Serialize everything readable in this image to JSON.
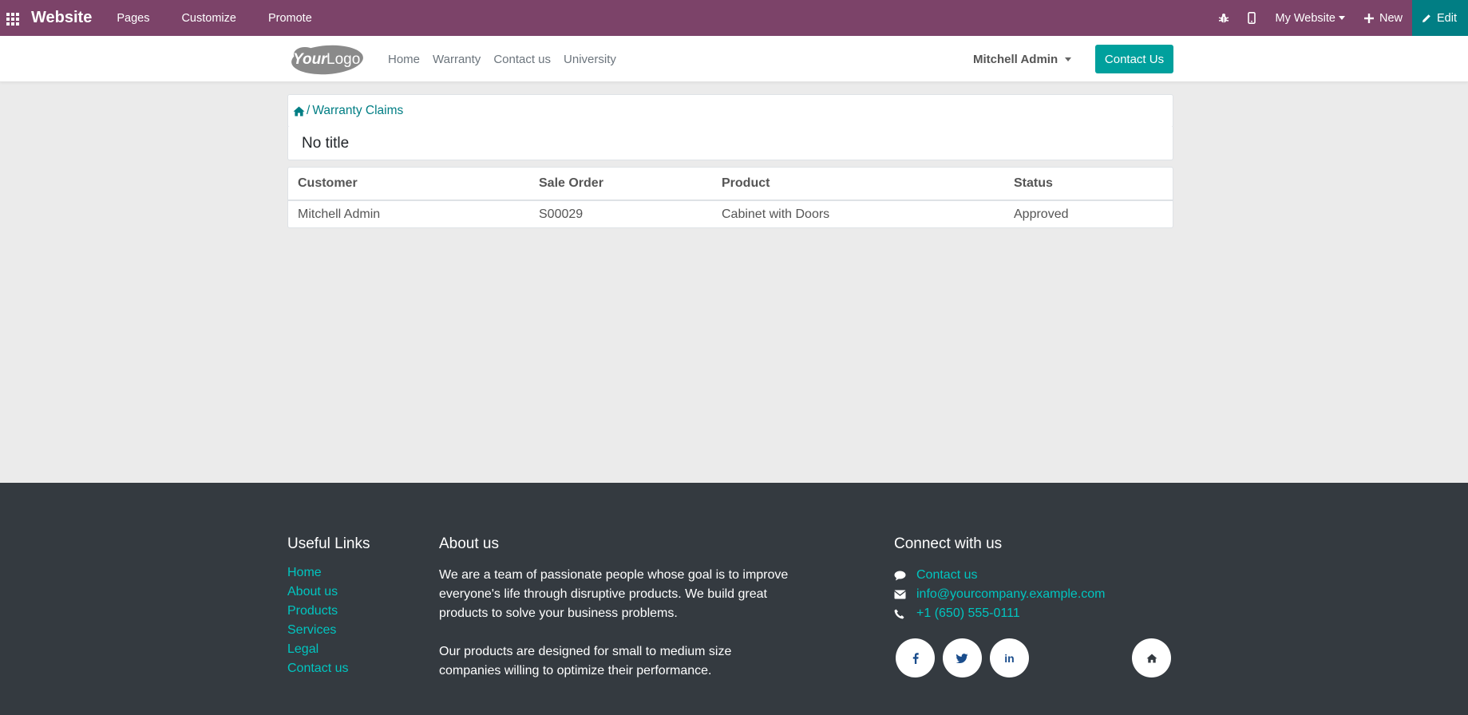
{
  "admin_bar": {
    "brand": "Website",
    "menu": [
      "Pages",
      "Customize",
      "Promote"
    ],
    "right": {
      "website_selector": "My Website",
      "new_label": "New",
      "edit_label": "Edit"
    },
    "colors": {
      "background": "#7c4369",
      "edit_background": "#017e84"
    }
  },
  "header": {
    "logo_text": "YourLogo",
    "nav": [
      "Home",
      "Warranty",
      "Contact us",
      "University"
    ],
    "user": "Mitchell Admin",
    "cta": "Contact Us",
    "colors": {
      "cta": "#00a09d"
    }
  },
  "main": {
    "breadcrumb": {
      "icon": "home-icon",
      "separator": "/",
      "current": "Warranty Claims"
    },
    "record_title": "No title",
    "table": {
      "columns": [
        "Customer",
        "Sale Order",
        "Product",
        "Status"
      ],
      "rows": [
        {
          "customer": "Mitchell Admin",
          "sale_order": "S00029",
          "product": "Cabinet with Doors",
          "status": "Approved"
        }
      ]
    }
  },
  "footer": {
    "useful_links": {
      "title": "Useful Links",
      "items": [
        "Home",
        "About us",
        "Products",
        "Services",
        "Legal",
        "Contact us"
      ]
    },
    "about": {
      "title": "About us",
      "p1": "We are a team of passionate people whose goal is to improve everyone's life through disruptive products. We build great products to solve your business problems.",
      "p2": "Our products are designed for small to medium size companies willing to optimize their performance."
    },
    "connect": {
      "title": "Connect with us",
      "contact": "Contact us",
      "email": "info@yourcompany.example.com",
      "phone": "+1 (650) 555-0111"
    },
    "social": [
      "facebook-icon",
      "twitter-icon",
      "linkedin-icon",
      "home-icon"
    ],
    "colors": {
      "background": "#343a40",
      "link": "#00c5c0"
    }
  }
}
